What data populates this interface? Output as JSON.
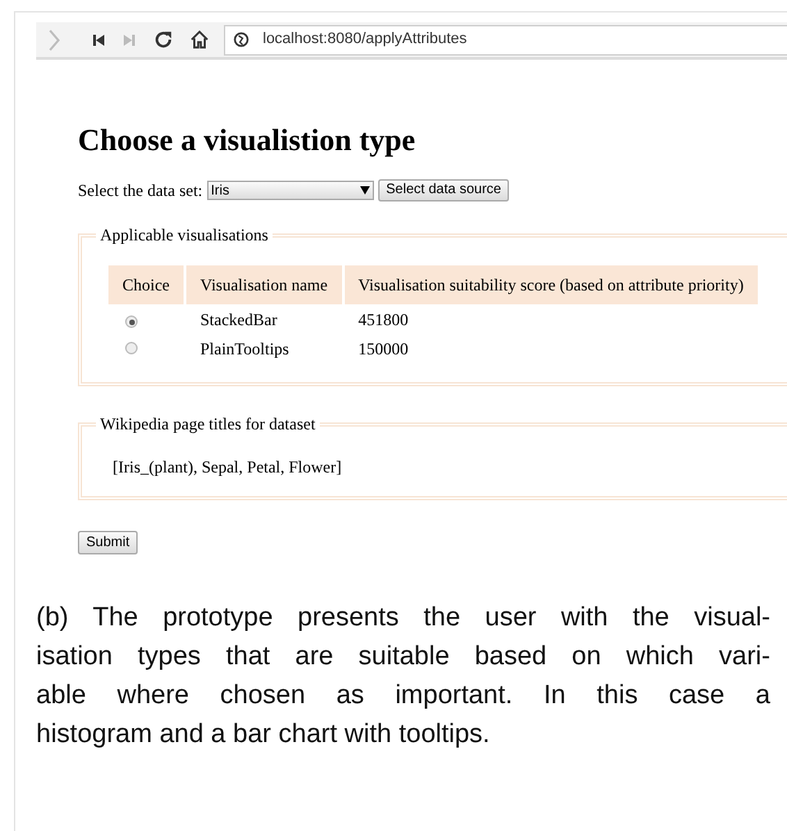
{
  "browser": {
    "url": "localhost:8080/applyAttributes"
  },
  "heading": "Choose a visualistion type",
  "dataset": {
    "label": "Select the data set:",
    "value": "Iris",
    "button": "Select data source"
  },
  "visualisations": {
    "legend": "Applicable visualisations",
    "columns": [
      "Choice",
      "Visualisation name",
      "Visualisation suitability score (based on attribute priority)"
    ],
    "rows": [
      {
        "selected": true,
        "name": "StackedBar",
        "score": "451800"
      },
      {
        "selected": false,
        "name": "PlainTooltips",
        "score": "150000"
      }
    ]
  },
  "wikipedia": {
    "legend": "Wikipedia page titles for dataset",
    "text": "[Iris_(plant), Sepal, Petal, Flower]"
  },
  "submit": "Submit",
  "caption": [
    "(b)  The prototype presents the user with the visual-",
    "isation types that are suitable based on which vari-",
    "able where chosen as important.  In this case a",
    "histogram and a bar chart with tooltips."
  ]
}
